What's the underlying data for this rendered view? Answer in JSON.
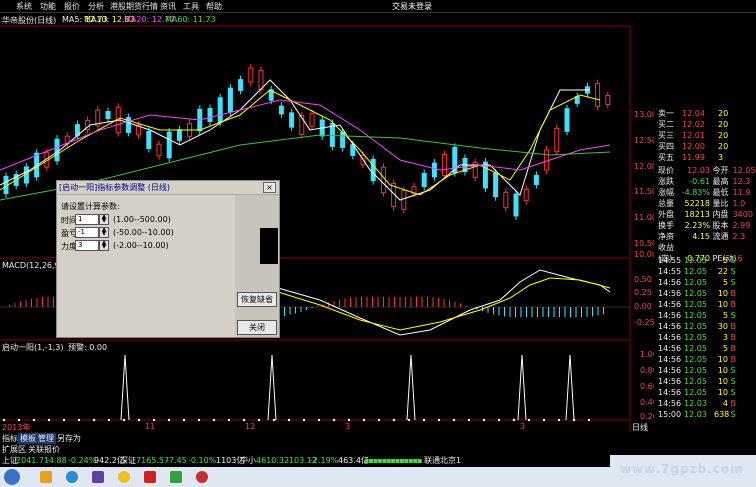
{
  "menu": {
    "items": [
      "系统",
      "功能",
      "报价",
      "分析",
      "港股期货行情",
      "资讯",
      "工具",
      "帮助"
    ],
    "right": "交易未登录"
  },
  "header": {
    "stock": "华帝股份(日线)",
    "ma5": "MA5: 12.73",
    "ma10": "MA10: 12.83",
    "ma20": "MA20: 12.77",
    "ma60": "MA60: 11.73"
  },
  "price_axis": [
    "13.00",
    "12.50",
    "12.00",
    "11.50",
    "11.00",
    "10.50",
    "10.00"
  ],
  "macd": {
    "label": "MACD(12,26,9)",
    "axis": [
      "0.50",
      "0.25",
      "0.00",
      "-0.25"
    ]
  },
  "indicator": {
    "label": "启动一阳(1,-1,3)",
    "alarm": "预警: 0.00",
    "axis": [
      "1.00",
      "0.80",
      "0.60",
      "0.40",
      "0.20"
    ]
  },
  "date_axis": {
    "year": "2013年",
    "m1": "11",
    "m2": "12",
    "m3": "3",
    "m4": "3"
  },
  "quote": {
    "sell": [
      {
        "label": "卖一",
        "price": "12.04",
        "vol": "20"
      },
      {
        "label": "买二",
        "price": "12.02",
        "vol": "20"
      },
      {
        "label": "买三",
        "price": "12.01",
        "vol": "20"
      },
      {
        "label": "买四",
        "price": "12.00",
        "vol": "20"
      },
      {
        "label": "买五",
        "price": "11.99",
        "vol": "3"
      }
    ],
    "stats": [
      {
        "a": "现价",
        "b": "12.03",
        "c": "今开",
        "d": "12.05"
      },
      {
        "a": "涨跌",
        "b": "-0.61",
        "c": "最高",
        "d": "12.3"
      },
      {
        "a": "涨幅",
        "b": "-4.83%",
        "c": "最低",
        "d": "11.9"
      },
      {
        "a": "总量",
        "b": "52218",
        "c": "量比",
        "d": "1.0"
      },
      {
        "a": "外盘",
        "b": "18213",
        "c": "内盘",
        "d": "3400"
      },
      {
        "a": "换手",
        "b": "2.23%",
        "c": "股本",
        "d": "2.99"
      },
      {
        "a": "净资",
        "b": "4.15",
        "c": "流通",
        "d": "2.3"
      },
      {
        "a": "收益(四)",
        "b": "0.770",
        "c": "PE(动)",
        "d": "16"
      }
    ],
    "ticks": [
      {
        "t": "14:55",
        "p": "12.05",
        "v": "5",
        "s": "S"
      },
      {
        "t": "14:55",
        "p": "12.05",
        "v": "22",
        "s": "S"
      },
      {
        "t": "14:56",
        "p": "12.05",
        "v": "5",
        "s": "S"
      },
      {
        "t": "14:56",
        "p": "12.05",
        "v": "10",
        "s": "B"
      },
      {
        "t": "14:56",
        "p": "12.05",
        "v": "10",
        "s": "B"
      },
      {
        "t": "14:56",
        "p": "12.05",
        "v": "5",
        "s": "S"
      },
      {
        "t": "14:56",
        "p": "12.05",
        "v": "30",
        "s": "B"
      },
      {
        "t": "14:56",
        "p": "12.05",
        "v": "3",
        "s": "B"
      },
      {
        "t": "14:56",
        "p": "12.05",
        "v": "5",
        "s": "B"
      },
      {
        "t": "14:56",
        "p": "12.05",
        "v": "10",
        "s": "B"
      },
      {
        "t": "14:56",
        "p": "12.05",
        "v": "10",
        "s": "S"
      },
      {
        "t": "14:56",
        "p": "12.05",
        "v": "10",
        "s": "S"
      },
      {
        "t": "14:56",
        "p": "12.05",
        "v": "10",
        "s": "S"
      },
      {
        "t": "14:56",
        "p": "12.03",
        "v": "4",
        "s": "B"
      },
      {
        "t": "15:00",
        "p": "12.03",
        "v": "638",
        "s": "S"
      }
    ],
    "day_label": "日线"
  },
  "dialog": {
    "title": "[启动一阳]指标参数调整 (日线)",
    "prompt": "请设置计算参数:",
    "params": [
      {
        "label": "时间:",
        "value": "1",
        "range": "(1.00--500.00)"
      },
      {
        "label": "盈亏:",
        "value": "-1",
        "range": "(-50.00--10.00)"
      },
      {
        "label": "力度:",
        "value": "3",
        "range": "(-2.00--10.00)"
      }
    ],
    "restore_btn": "恢复缺省",
    "close_btn": "关闭"
  },
  "tabs": [
    "指标",
    "模板",
    "管理",
    "另存为"
  ],
  "tabs2": [
    "扩展区",
    "关联报价"
  ],
  "status": {
    "sh": "上证",
    "sh_val": "2041.71",
    "sh_chg": "-4.88",
    "sh_pct": "-0.24%",
    "sh_amt": "942.2亿",
    "sz": "深证",
    "sz_val": "7165.57",
    "sz_chg": "-7.45",
    "sz_pct": "-0.10%",
    "sz_amt": "1103亿",
    "zx": "中小",
    "zx_val": "4610.32",
    "zx_chg": "-103.12",
    "zx_pct": "-2.19%",
    "zx_amt": "463.4亿",
    "conn": "联通北京1"
  },
  "watermark": "www.7gpzb.com",
  "colors": {
    "up": "#ff3030",
    "down": "#40e0ff",
    "ma5": "#ffffff",
    "ma10": "#ffff00",
    "ma20": "#ff40ff",
    "ma60": "#40c040"
  }
}
